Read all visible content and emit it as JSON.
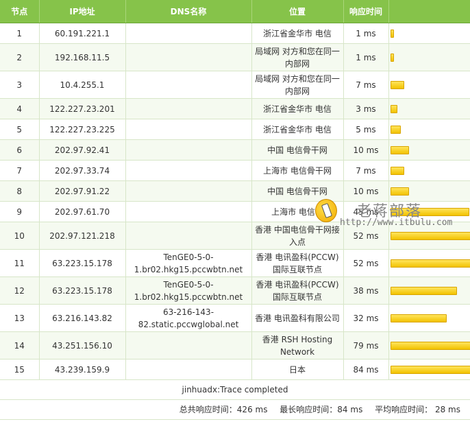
{
  "headers": {
    "node": "节点",
    "ip": "IP地址",
    "dns": "DNS名称",
    "location": "位置",
    "time": "响应时间"
  },
  "rows": [
    {
      "node": "1",
      "ip": "60.191.221.1",
      "dns": "",
      "location": "浙江省金华市 电信",
      "time": "1 ms",
      "ms": 1
    },
    {
      "node": "2",
      "ip": "192.168.11.5",
      "dns": "",
      "location": "局域网 对方和您在同一内部网",
      "time": "1 ms",
      "ms": 1
    },
    {
      "node": "3",
      "ip": "10.4.255.1",
      "dns": "",
      "location": "局域网 对方和您在同一内部网",
      "time": "7 ms",
      "ms": 7
    },
    {
      "node": "4",
      "ip": "122.227.23.201",
      "dns": "",
      "location": "浙江省金华市 电信",
      "time": "3 ms",
      "ms": 3
    },
    {
      "node": "5",
      "ip": "122.227.23.225",
      "dns": "",
      "location": "浙江省金华市 电信",
      "time": "5 ms",
      "ms": 5
    },
    {
      "node": "6",
      "ip": "202.97.92.41",
      "dns": "",
      "location": "中国 电信骨干网",
      "time": "10 ms",
      "ms": 10
    },
    {
      "node": "7",
      "ip": "202.97.33.74",
      "dns": "",
      "location": "上海市 电信骨干网",
      "time": "7 ms",
      "ms": 7
    },
    {
      "node": "8",
      "ip": "202.97.91.22",
      "dns": "",
      "location": "中国 电信骨干网",
      "time": "10 ms",
      "ms": 10
    },
    {
      "node": "9",
      "ip": "202.97.61.70",
      "dns": "",
      "location": "上海市 电信骨",
      "time": "45 ms",
      "ms": 45
    },
    {
      "node": "10",
      "ip": "202.97.121.218",
      "dns": "",
      "location": "香港 中国电信骨干网接入点",
      "time": "52 ms",
      "ms": 52
    },
    {
      "node": "11",
      "ip": "63.223.15.178",
      "dns": "TenGE0-5-0-1.br02.hkg15.pccwbtn.net",
      "location": "香港 电讯盈科(PCCW)国际互联节点",
      "time": "52 ms",
      "ms": 52
    },
    {
      "node": "12",
      "ip": "63.223.15.178",
      "dns": "TenGE0-5-0-1.br02.hkg15.pccwbtn.net",
      "location": "香港 电讯盈科(PCCW)国际互联节点",
      "time": "38 ms",
      "ms": 38
    },
    {
      "node": "13",
      "ip": "63.216.143.82",
      "dns": "63-216-143-82.static.pccwglobal.net",
      "location": "香港 电讯盈科有限公司",
      "time": "32 ms",
      "ms": 32
    },
    {
      "node": "14",
      "ip": "43.251.156.10",
      "dns": "",
      "location": "香港 RSH Hosting Network",
      "time": "79 ms",
      "ms": 79
    },
    {
      "node": "15",
      "ip": "43.239.159.9",
      "dns": "",
      "location": "日本",
      "time": "84 ms",
      "ms": 84
    }
  ],
  "status": "jinhuadx:Trace completed",
  "summary": {
    "total": "总共响应时间：426 ms",
    "max": "最长响应时间：84 ms",
    "avg": "平均响应时间： 28 ms"
  },
  "watermark": {
    "title": "老蒋部落",
    "url": "http://www.itbulu.com"
  },
  "colors": {
    "header_bg": "#86c34a",
    "bar": "#f2c200"
  }
}
